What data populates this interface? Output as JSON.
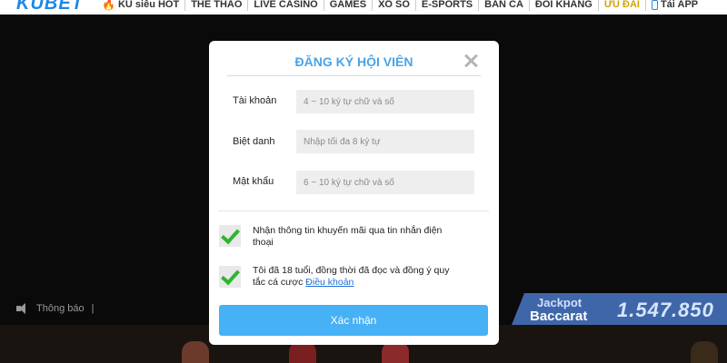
{
  "header": {
    "logo": "KUBET",
    "nav": [
      {
        "label": "KU siêu HOT",
        "icon": "fire-icon"
      },
      {
        "label": "THỂ THAO"
      },
      {
        "label": "LIVE CASINO"
      },
      {
        "label": "GAMES"
      },
      {
        "label": "XỔ SỐ"
      },
      {
        "label": "E-SPORTS"
      },
      {
        "label": "BẮN CÁ"
      },
      {
        "label": "ĐỐI KHÁNG"
      },
      {
        "label": "ƯU ĐÃI",
        "active": true
      },
      {
        "label": "Tải APP",
        "icon": "phone-icon"
      }
    ]
  },
  "notice": {
    "label": "Thông báo",
    "separator": "|",
    "icon": "speaker-icon"
  },
  "jackpot": {
    "title": "Jackpot",
    "game": "Baccarat",
    "amount": "1.547.850"
  },
  "modal": {
    "title": "ĐĂNG KÝ HỘI VIÊN",
    "close_icon": "close-icon",
    "fields": {
      "account": {
        "label": "Tài khoản",
        "placeholder": "4 ~ 10 ký tự chữ và số"
      },
      "nickname": {
        "label": "Biệt danh",
        "placeholder": "Nhập tối đa 8 ký tự"
      },
      "password": {
        "label": "Mật khẩu",
        "placeholder": "6 ~ 10 ký tự chữ và số"
      }
    },
    "checks": {
      "promo": {
        "text": "Nhận thông tin khuyến mãi qua tin nhắn điện thoại",
        "checked": true
      },
      "terms": {
        "text": "Tôi đã 18 tuổi, đồng thời đã đọc và đồng ý quy tắc cá cược",
        "link": "Điều khoản",
        "checked": true
      }
    },
    "submit_label": "Xác nhận"
  },
  "colors": {
    "accent": "#46b1f5",
    "title": "#4aa3e6",
    "check": "#2db52d",
    "link": "#1e6fd6",
    "jackpot_bg": "#3f66a8"
  }
}
